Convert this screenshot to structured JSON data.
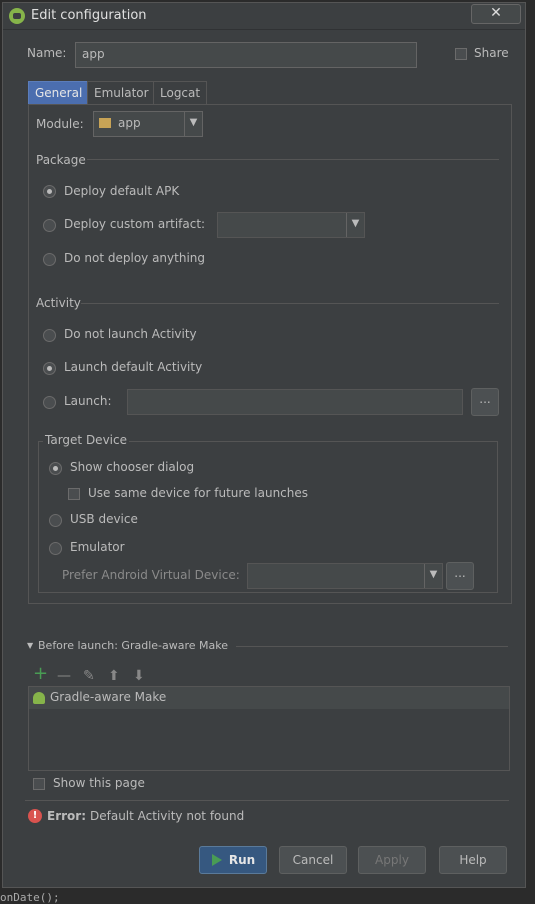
{
  "window": {
    "title": "Edit configuration",
    "close_glyph": "✕"
  },
  "name_row": {
    "label": "Name:",
    "value": "app",
    "share_label": "Share"
  },
  "tabs": [
    {
      "label": "General",
      "active": true
    },
    {
      "label": "Emulator"
    },
    {
      "label": "Logcat"
    }
  ],
  "module": {
    "label": "Module:",
    "value": "app"
  },
  "package": {
    "title": "Package",
    "options": [
      {
        "label": "Deploy default APK",
        "selected": true
      },
      {
        "label": "Deploy custom artifact:"
      },
      {
        "label": "Do not deploy anything"
      }
    ]
  },
  "activity": {
    "title": "Activity",
    "options": [
      {
        "label": "Do not launch Activity"
      },
      {
        "label": "Launch default Activity",
        "selected": true
      },
      {
        "label": "Launch:"
      }
    ],
    "browse_label": "..."
  },
  "target_device": {
    "title": "Target Device",
    "show_chooser": "Show chooser dialog",
    "use_same": "Use same device for future launches",
    "usb": "USB device",
    "emulator": "Emulator",
    "prefer_avd": "Prefer Android Virtual Device:",
    "browse_label": "..."
  },
  "before_launch": {
    "title": "Before launch: Gradle-aware Make",
    "items": [
      "Gradle-aware Make"
    ],
    "show_page": "Show this page"
  },
  "error": {
    "prefix": "Error:",
    "message": "Default Activity not found"
  },
  "buttons": {
    "run": "Run",
    "cancel": "Cancel",
    "apply": "Apply",
    "help": "Help"
  },
  "bottom_text": "onDate();",
  "colors": {
    "accent": "#4b6eaf",
    "android_green": "#86b44a",
    "error_red": "#d9534f",
    "add_green": "#499c54"
  }
}
